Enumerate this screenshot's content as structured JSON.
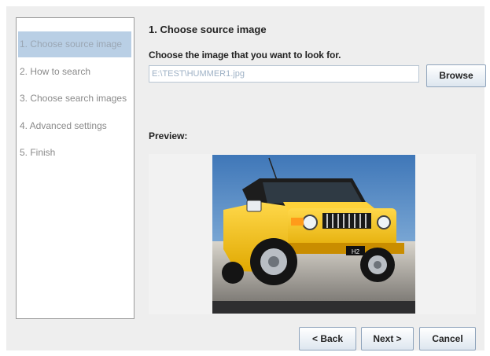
{
  "wizard": {
    "steps": [
      {
        "label": "1. Choose source image",
        "active": true
      },
      {
        "label": "2. How to search",
        "active": false
      },
      {
        "label": "3. Choose search images",
        "active": false
      },
      {
        "label": "4. Advanced settings",
        "active": false
      },
      {
        "label": "5. Finish",
        "active": false
      }
    ]
  },
  "main": {
    "title": "1. Choose source image",
    "instruction": "Choose the image that you want to look for.",
    "path_value": "E:\\TEST\\HUMMER1.jpg",
    "browse_label": "Browse",
    "preview_label": "Preview:"
  },
  "preview_image": {
    "icon": "yellow-suv-photo"
  },
  "footer": {
    "back_label": "< Back",
    "next_label": "Next >",
    "cancel_label": "Cancel"
  },
  "colors": {
    "active_step_bg": "#b9cfe5",
    "dialog_bg": "#eeeeee",
    "button_border": "#8ea3bb"
  }
}
